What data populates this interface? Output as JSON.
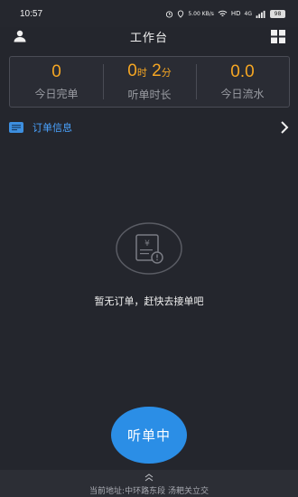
{
  "status": {
    "time": "10:57",
    "net_speed": "5.00 KB/s",
    "hd": "HD",
    "signal": "4G",
    "battery": "98"
  },
  "header": {
    "title": "工作台",
    "left_icon": "user-icon",
    "right_icon": "grid-icon"
  },
  "stats": [
    {
      "value": "0",
      "label": "今日完单"
    },
    {
      "value_hours": "0",
      "unit_hours": "时",
      "value_minutes": "2",
      "unit_minutes": "分",
      "label": "听单时长"
    },
    {
      "value": "0.0",
      "label": "今日流水"
    }
  ],
  "order_info": {
    "label": "订单信息",
    "icon": "list-icon"
  },
  "empty": {
    "message": "暂无订单，赶快去接单吧",
    "icon": "receipt-icon"
  },
  "listen_button": {
    "label": "听单中"
  },
  "bottom": {
    "address": "当前地址:中环路东段  汤耙关立交"
  },
  "colors": {
    "background": "#24262d",
    "accent_orange": "#f5a623",
    "accent_blue": "#2b8ee6",
    "link_blue": "#4aa3ff"
  }
}
